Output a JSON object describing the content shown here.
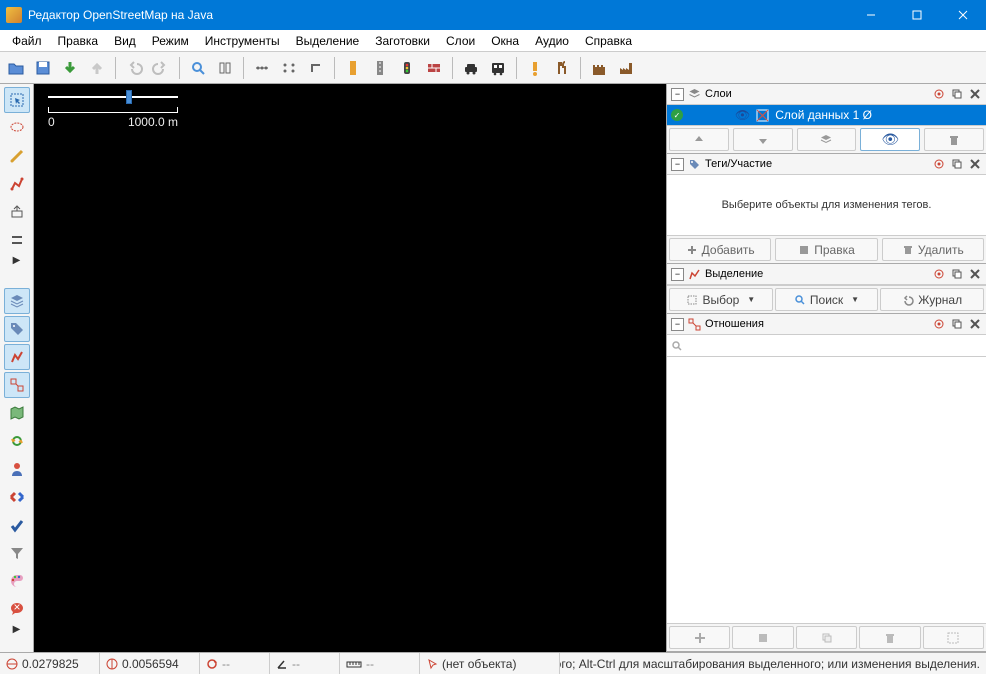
{
  "title": "Редактор OpenStreetMap на Java",
  "menu": [
    "Файл",
    "Правка",
    "Вид",
    "Режим",
    "Инструменты",
    "Выделение",
    "Заготовки",
    "Слои",
    "Окна",
    "Аудио",
    "Справка"
  ],
  "scale": {
    "start": "0",
    "end": "1000.0 m"
  },
  "panels": {
    "layers": {
      "title": "Слои",
      "item": "Слой данных 1 Ø"
    },
    "tags": {
      "title": "Теги/Участие",
      "hint": "Выберите объекты для изменения тегов.",
      "add": "Добавить",
      "edit": "Правка",
      "del": "Удалить"
    },
    "selection": {
      "title": "Выделение",
      "select": "Выбор",
      "search": "Поиск",
      "history": "Журнал"
    },
    "relations": {
      "title": "Отношения"
    }
  },
  "status": {
    "lat": "0.0279825",
    "lon": "0.0056594",
    "heading_icon": "⟳",
    "angle_icon": "∠",
    "ruler_icon": "▭",
    "object": "(нет объекта)",
    "hint": "ого; Alt-Ctrl для масштабирования выделенного; или изменения выделения."
  }
}
